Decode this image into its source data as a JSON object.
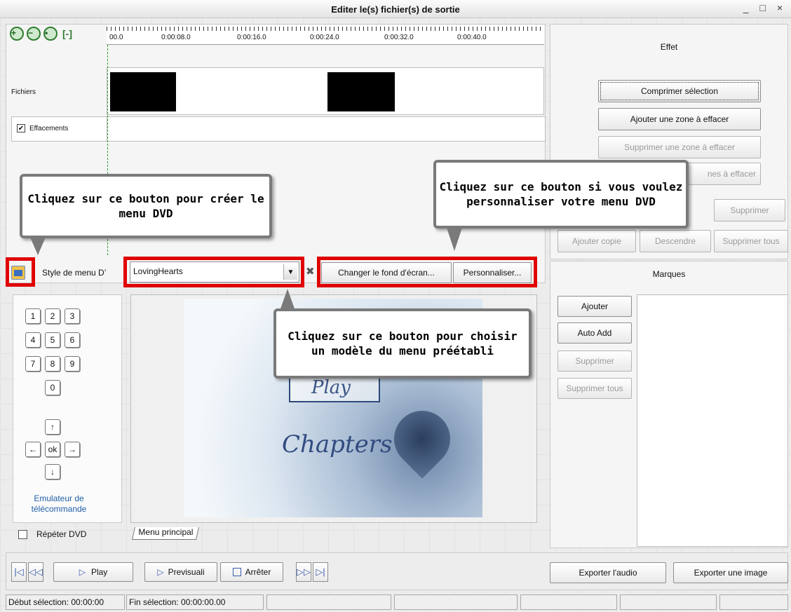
{
  "window": {
    "title": "Editer le(s) fichier(s) de sortie",
    "controls": "_ □ ×"
  },
  "timeline": {
    "ticks": [
      "00.0",
      "0:00:08.0",
      "0:00:16.0",
      "0:00:24.0",
      "0:00:32.0",
      "0:00:40.0"
    ],
    "tracks": {
      "files": "Fichiers",
      "erase": "Effacements"
    },
    "erase_checked": true
  },
  "effect_panel": {
    "title": "Effet",
    "compress": "Comprimer sélection",
    "add_zone": "Ajouter une zone à effacer",
    "remove_zone": "Supprimer une zone à effacer",
    "remove_zones_partial": "nes à effacer",
    "delete": "Supprimer",
    "add_copy": "Ajouter copie",
    "move_down": "Descendre",
    "delete_all": "Supprimer tous"
  },
  "menu_bar": {
    "style_label": "Style de menu D’",
    "style_value": "LovingHearts",
    "change_bg": "Changer le fond d'écran...",
    "customize": "Personnaliser..."
  },
  "remote": {
    "keys": [
      "1",
      "2",
      "3",
      "4",
      "5",
      "6",
      "7",
      "8",
      "9",
      "0"
    ],
    "ok": "ok",
    "arrows": {
      "up": "↑",
      "down": "↓",
      "left": "←",
      "right": "→"
    },
    "label": "Emulateur de télécommande"
  },
  "preview": {
    "play_text": "Play",
    "chapters_text": "Chapters",
    "tab": "Menu principal"
  },
  "repeat_dvd": {
    "label": "Répéter DVD",
    "checked": false
  },
  "marks_panel": {
    "title": "Marques",
    "add": "Ajouter",
    "auto_add": "Auto Add",
    "delete": "Supprimer",
    "delete_all": "Supprimer tous"
  },
  "transport": {
    "play": "Play",
    "preview": "Previsuali",
    "stop": "Arrêter",
    "export_audio": "Exporter l'audio",
    "export_image": "Exporter une image"
  },
  "status_bar": {
    "start": "Début sélection: 00:00:00",
    "end": "Fin sélection: 00:00:00.00"
  },
  "callouts": {
    "create_menu": "Cliquez sur ce bouton pour créer le menu DVD",
    "customize_menu": "Cliquez sur ce bouton si vous voulez personnaliser votre menu DVD",
    "choose_template": "Cliquez sur ce bouton pour choisir un modèle du menu préétabli"
  },
  "colors": {
    "highlight": "#e00000",
    "accent_link": "#1f5fa8",
    "icon_green": "#2f7d2f"
  }
}
